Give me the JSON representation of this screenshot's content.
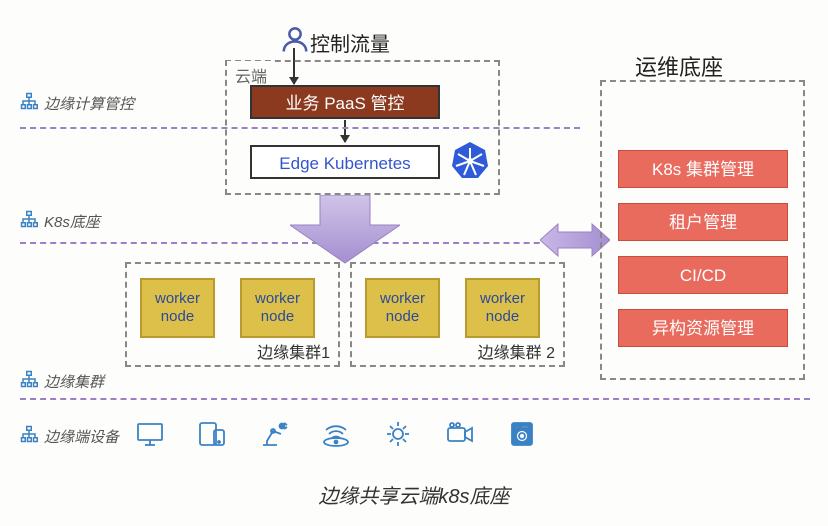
{
  "top": {
    "control_traffic": "控制流量",
    "cloud_label": "云端",
    "paas": "业务 PaaS 管控",
    "edge_k8s": "Edge Kubernetes"
  },
  "layers": {
    "edge_compute": "边缘计算管控",
    "k8s_base": "K8s底座",
    "edge_cluster": "边缘集群",
    "edge_device": "边缘端设备"
  },
  "clusters": {
    "c1": {
      "label": "边缘集群1",
      "w1": "worker\nnode",
      "w2": "worker\nnode"
    },
    "c2": {
      "label": "边缘集群 2",
      "w1": "worker\nnode",
      "w2": "worker\nnode"
    }
  },
  "ops": {
    "title": "运维底座",
    "items": [
      "K8s 集群管理",
      "租户管理",
      "CI/CD",
      "异构资源管理"
    ]
  },
  "bottom_title": "边缘共享云端k8s底座"
}
